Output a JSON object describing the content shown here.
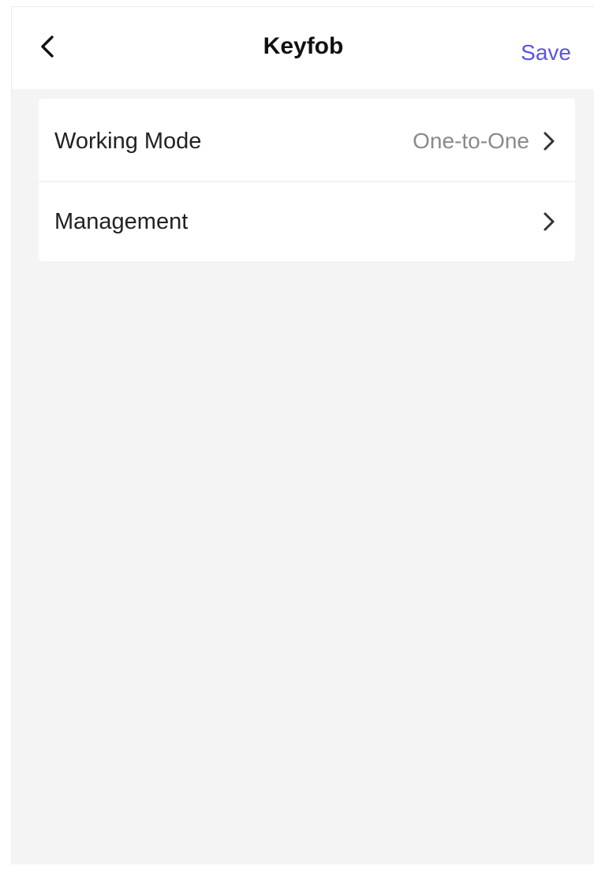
{
  "header": {
    "title": "Keyfob",
    "save_label": "Save",
    "back_icon": "chevron-left-icon"
  },
  "settings": {
    "items": [
      {
        "label": "Working Mode",
        "value": "One-to-One",
        "icon": "chevron-right-icon"
      },
      {
        "label": "Management",
        "value": "",
        "icon": "chevron-right-icon"
      }
    ]
  },
  "colors": {
    "accent": "#5a55e0",
    "background": "#f4f4f5",
    "card": "#ffffff",
    "value_text": "#8a8a8a"
  }
}
